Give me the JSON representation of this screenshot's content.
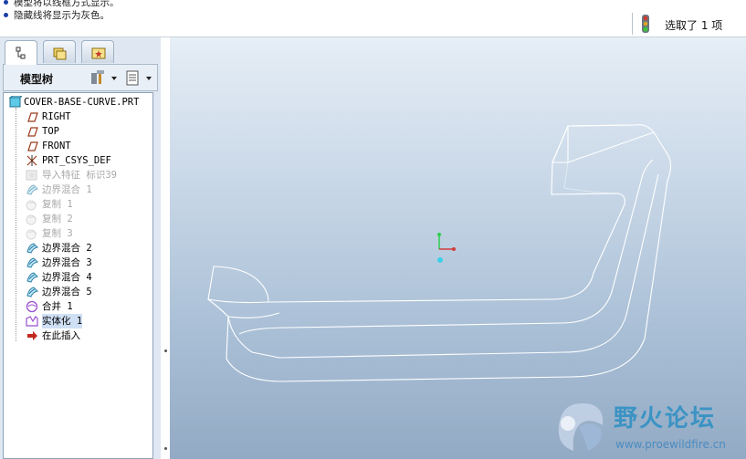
{
  "messages": [
    "模型将以线框方式显示。",
    "隐藏线将显示为灰色。"
  ],
  "status": {
    "selection_text": "选取了 1 项"
  },
  "panel": {
    "tabs": [
      {
        "name": "model-tree-tab",
        "active": true
      },
      {
        "name": "folder-browser-tab",
        "active": false
      },
      {
        "name": "favorites-tab",
        "active": false
      }
    ],
    "title": "模型树"
  },
  "tree": {
    "root": "COVER-BASE-CURVE.PRT",
    "items": [
      {
        "label": "RIGHT",
        "icon": "datum-plane-icon",
        "dim": false,
        "selected": false
      },
      {
        "label": "TOP",
        "icon": "datum-plane-icon",
        "dim": false,
        "selected": false
      },
      {
        "label": "FRONT",
        "icon": "datum-plane-icon",
        "dim": false,
        "selected": false
      },
      {
        "label": "PRT_CSYS_DEF",
        "icon": "coordinate-system-icon",
        "dim": false,
        "selected": false
      },
      {
        "label": "导入特征 标识39",
        "icon": "import-feature-icon",
        "dim": true,
        "selected": false
      },
      {
        "label": "边界混合 1",
        "icon": "boundary-blend-icon",
        "dim": true,
        "selected": false
      },
      {
        "label": "复制 1",
        "icon": "copy-icon",
        "dim": true,
        "selected": false
      },
      {
        "label": "复制 2",
        "icon": "copy-icon",
        "dim": true,
        "selected": false
      },
      {
        "label": "复制 3",
        "icon": "copy-icon",
        "dim": true,
        "selected": false
      },
      {
        "label": "边界混合 2",
        "icon": "boundary-blend-icon",
        "dim": false,
        "selected": false
      },
      {
        "label": "边界混合 3",
        "icon": "boundary-blend-icon",
        "dim": false,
        "selected": false
      },
      {
        "label": "边界混合 4",
        "icon": "boundary-blend-icon",
        "dim": false,
        "selected": false
      },
      {
        "label": "边界混合 5",
        "icon": "boundary-blend-icon",
        "dim": false,
        "selected": false
      },
      {
        "label": "合并 1",
        "icon": "merge-icon",
        "dim": false,
        "selected": false
      },
      {
        "label": "实体化 1",
        "icon": "solidify-icon",
        "dim": false,
        "selected": true
      },
      {
        "label": "在此插入",
        "icon": "insert-here-arrow-icon",
        "dim": false,
        "selected": false
      }
    ]
  },
  "watermark": {
    "title": "野火论坛",
    "url": "www.proewildfire.cn"
  },
  "colors": {
    "viewport_top": "#e6eef6",
    "viewport_bottom": "#93aac4",
    "wireframe": "#ffffff",
    "selection_bg": "#cfe0f5",
    "dim_text": "#a8a8a8",
    "watermark_blue": "#3b93c4"
  }
}
